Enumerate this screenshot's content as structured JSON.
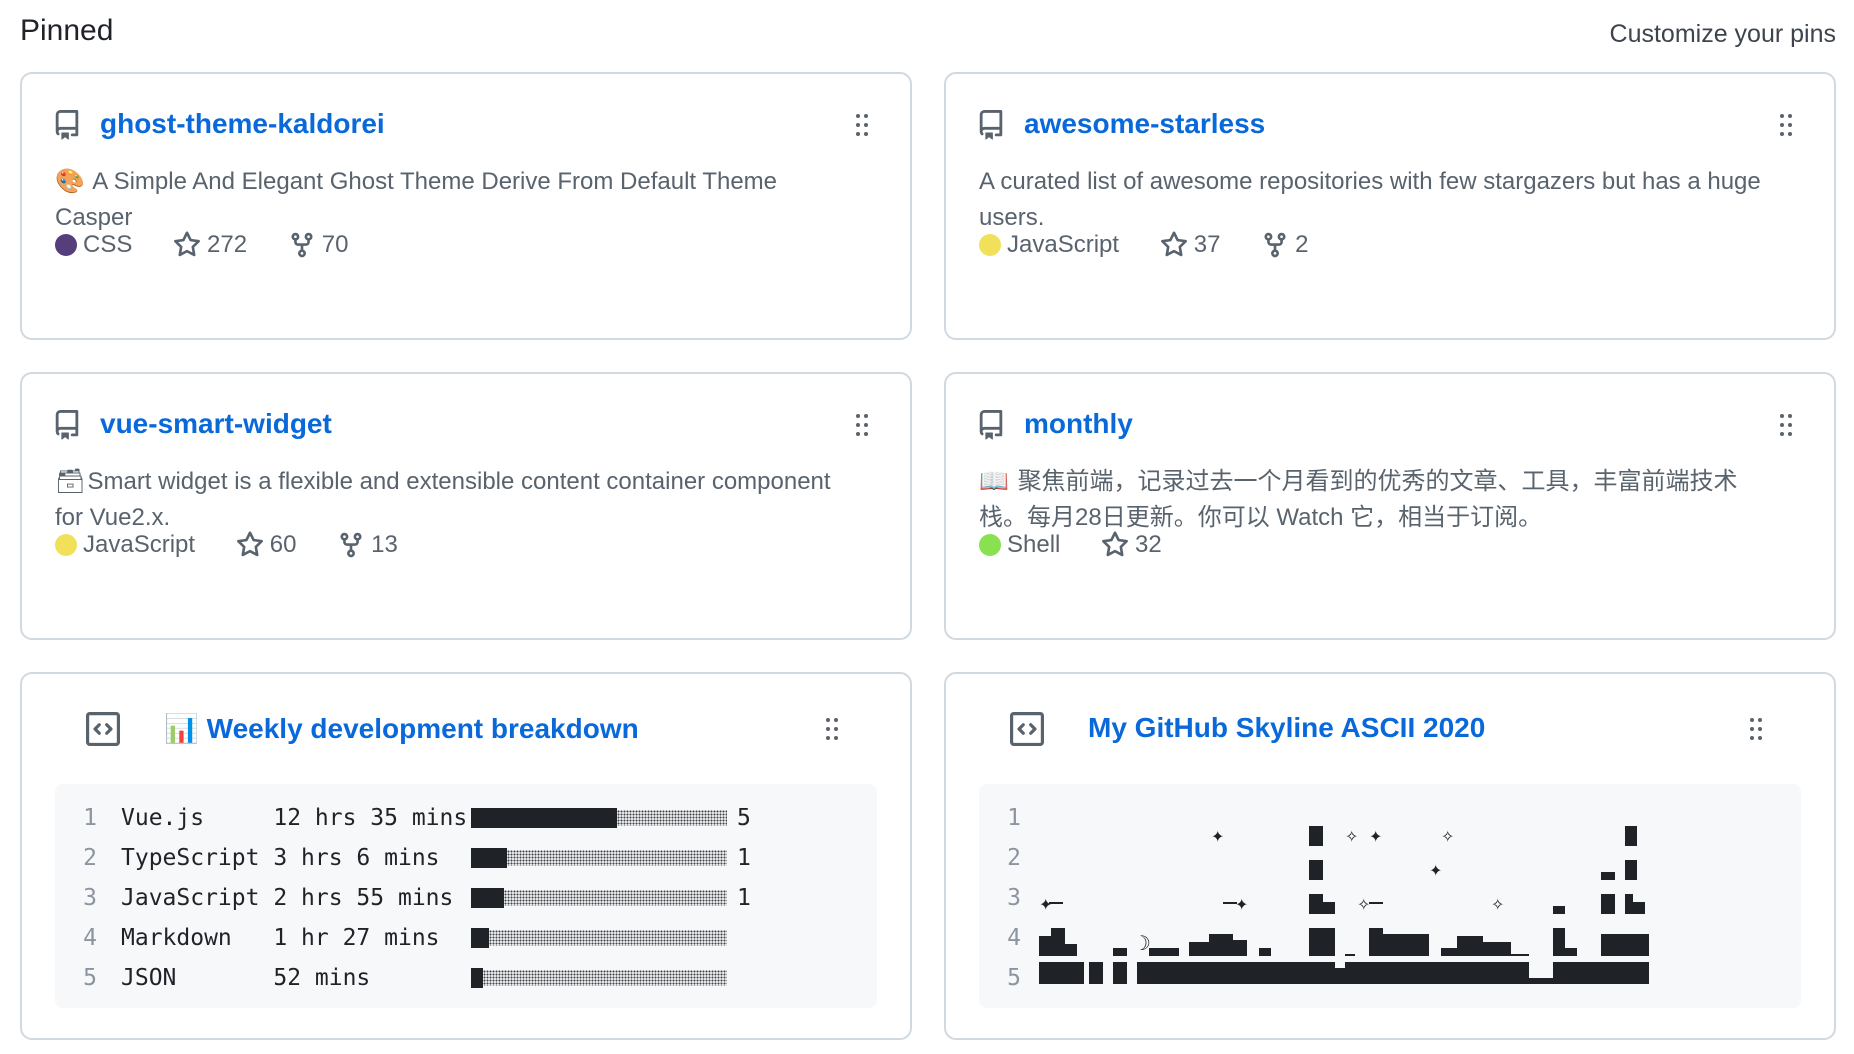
{
  "header": {
    "title": "Pinned",
    "customize_link": "Customize your pins"
  },
  "cards": [
    {
      "name": "ghost-theme-kaldorei",
      "desc_emoji": "🎨",
      "description": "A Simple And Elegant Ghost Theme Derive From Default Theme Casper",
      "language": "CSS",
      "language_color": "#563d7c",
      "stars": "272",
      "forks": "70"
    },
    {
      "name": "awesome-starless",
      "desc_emoji": "",
      "description": "A curated list of awesome repositories with few stargazers but has a huge users.",
      "language": "JavaScript",
      "language_color": "#f1e05a",
      "stars": "37",
      "forks": "2"
    },
    {
      "name": "vue-smart-widget",
      "desc_emoji": "🗃",
      "description": "Smart widget is a flexible and extensible content container component for Vue2.x.",
      "language": "JavaScript",
      "language_color": "#f1e05a",
      "stars": "60",
      "forks": "13"
    },
    {
      "name": "monthly",
      "desc_emoji": "📖",
      "description": "聚焦前端，记录过去一个月看到的优秀的文章、工具，丰富前端技术栈。每月28日更新。你可以 Watch 它，相当于订阅。",
      "language": "Shell",
      "language_color": "#89e051",
      "stars": "32",
      "forks": ""
    }
  ],
  "gists": [
    {
      "title_emoji": "📊",
      "title": "Weekly development breakdown",
      "lines": [
        {
          "num": "1",
          "lang": "Vue.js    ",
          "time": "12 hrs 35 mins",
          "fraction": 0.57,
          "pct": "5"
        },
        {
          "num": "2",
          "lang": "TypeScript",
          "time": "3 hrs 6 mins  ",
          "fraction": 0.14,
          "pct": "1"
        },
        {
          "num": "3",
          "lang": "JavaScript",
          "time": "2 hrs 55 mins ",
          "fraction": 0.13,
          "pct": "1"
        },
        {
          "num": "4",
          "lang": "Markdown  ",
          "time": "1 hr 27 mins  ",
          "fraction": 0.07,
          "pct": ""
        },
        {
          "num": "5",
          "lang": "JSON      ",
          "time": "52 mins       ",
          "fraction": 0.04,
          "pct": ""
        }
      ]
    },
    {
      "title_emoji": "",
      "title": "My GitHub Skyline ASCII 2020",
      "line_numbers": [
        "1",
        "2",
        "3",
        "4",
        "5"
      ]
    }
  ],
  "colors": {
    "link": "#0969da",
    "border": "#d1d9e0",
    "muted": "#59636e",
    "code_bg": "#f6f8fa"
  },
  "icons": [
    "repo-icon",
    "grip-icon",
    "star-icon",
    "fork-icon",
    "code-square-icon"
  ]
}
